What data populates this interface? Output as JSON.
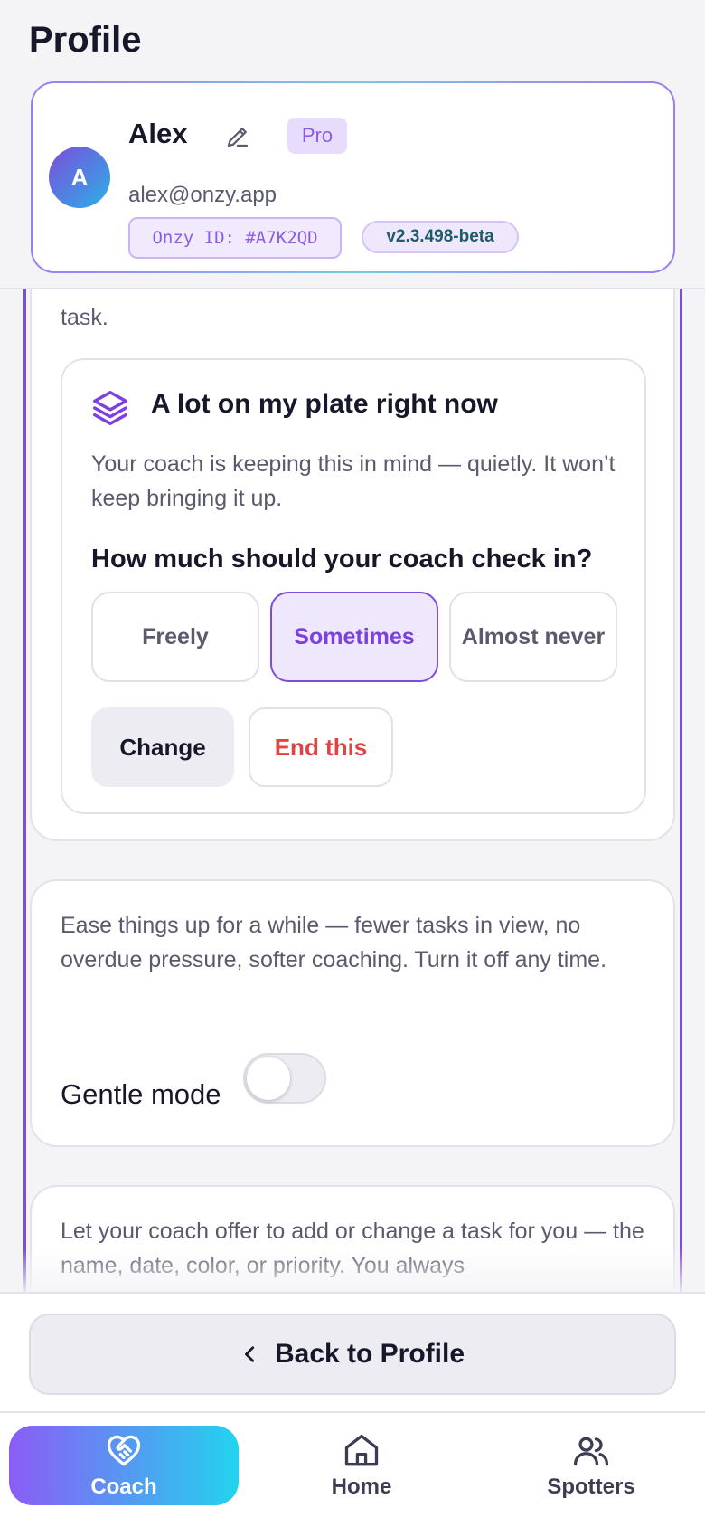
{
  "header": {
    "title": "Profile"
  },
  "profile": {
    "avatar_initial": "A",
    "name": "Alex",
    "plan_badge": "Pro",
    "email": "alex@onzy.app",
    "onzy_id": "Onzy ID: #A7K2QD",
    "version": "v2.3.498-beta"
  },
  "plate_card": {
    "partial_text": "task.",
    "title": "A lot on my plate right now",
    "description": "Your coach is keeping this in mind — quietly. It won’t keep bringing it up.",
    "question": "How much should your coach check in?",
    "options": [
      "Freely",
      "Sometimes",
      "Almost never"
    ],
    "selected_option": "Sometimes",
    "change_label": "Change",
    "end_label": "End this"
  },
  "gentle_card": {
    "description": "Ease things up for a while — fewer tasks in view, no overdue pressure, softer coaching. Turn it off any time.",
    "label": "Gentle mode",
    "enabled": false
  },
  "coach_edit_card": {
    "description": "Let your coach offer to add or change a task for you — the name, date, color, or priority. You always"
  },
  "back_button": {
    "label": "Back to Profile"
  },
  "tabs": [
    {
      "label": "Coach",
      "icon": "heart-handshake-icon",
      "active": true
    },
    {
      "label": "Home",
      "icon": "home-icon",
      "active": false
    },
    {
      "label": "Spotters",
      "icon": "users-icon",
      "active": false
    }
  ],
  "colors": {
    "accent": "#7c4ddb",
    "danger": "#e34242",
    "gradient_start": "#8b5cf6",
    "gradient_end": "#22d3ee"
  }
}
